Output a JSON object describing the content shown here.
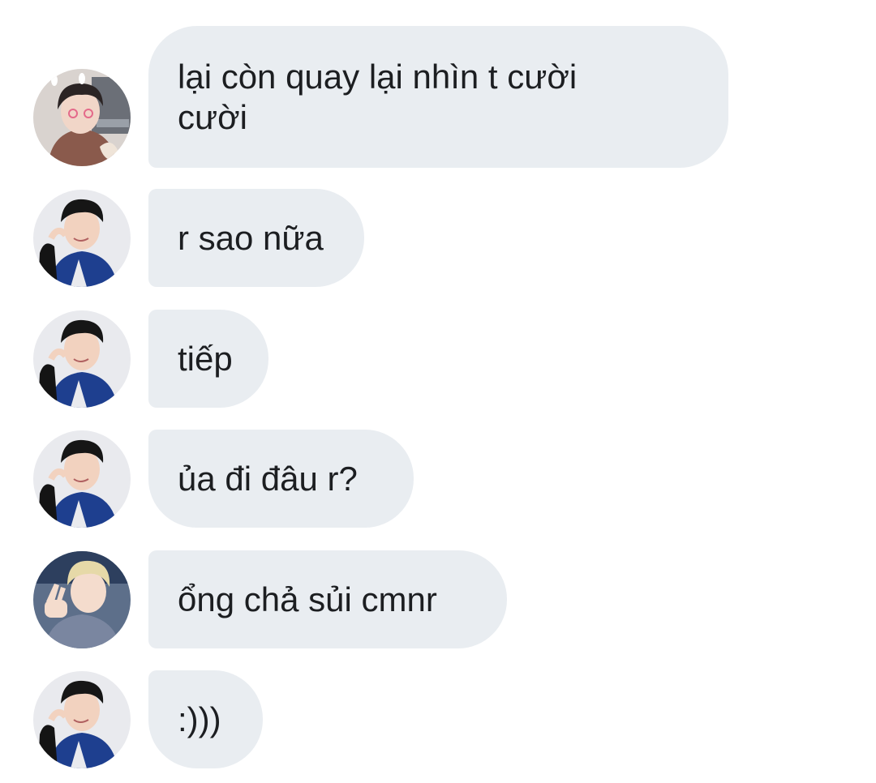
{
  "messages": [
    {
      "sender": "sender-a",
      "text": "lại còn quay lại nhìn t cười\ncười"
    },
    {
      "sender": "sender-b",
      "text": "r sao nữa"
    },
    {
      "sender": "sender-b",
      "text": "tiếp"
    },
    {
      "sender": "sender-b",
      "text": "ủa đi đâu r?"
    },
    {
      "sender": "sender-c",
      "text": "ổng chả sủi cmnr"
    },
    {
      "sender": "sender-b",
      "text": ":)))"
    }
  ],
  "colors": {
    "bubble_background": "#e9edf1",
    "text": "#1c1e21",
    "page_background": "#ffffff"
  }
}
